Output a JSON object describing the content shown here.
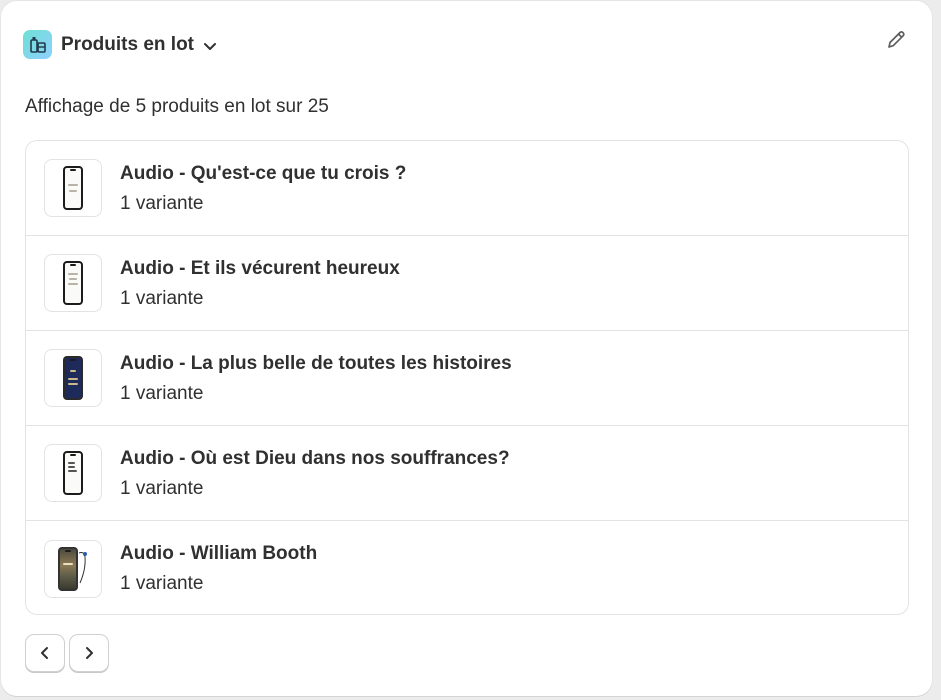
{
  "header": {
    "title": "Produits en lot",
    "app_icon": "bundle-app-icon",
    "chevron": "chevron-down-icon",
    "edit_icon": "pencil-icon"
  },
  "summary": "Affichage de 5 produits en lot sur 25",
  "products": [
    {
      "name": "Audio - Qu'est-ce que tu crois ?",
      "variants": "1 variante"
    },
    {
      "name": "Audio - Et ils vécurent heureux",
      "variants": "1 variante"
    },
    {
      "name": "Audio - La plus belle de toutes les histoires",
      "variants": "1 variante"
    },
    {
      "name": "Audio - Où est Dieu dans nos souffrances?",
      "variants": "1 variante"
    },
    {
      "name": "Audio - William Booth",
      "variants": "1 variante"
    }
  ],
  "pagination": {
    "prev_icon": "chevron-left-icon",
    "next_icon": "chevron-right-icon"
  },
  "colors": {
    "text": "#303030",
    "border": "#e3e3e3",
    "accent_icon": "#6ee0d3"
  }
}
